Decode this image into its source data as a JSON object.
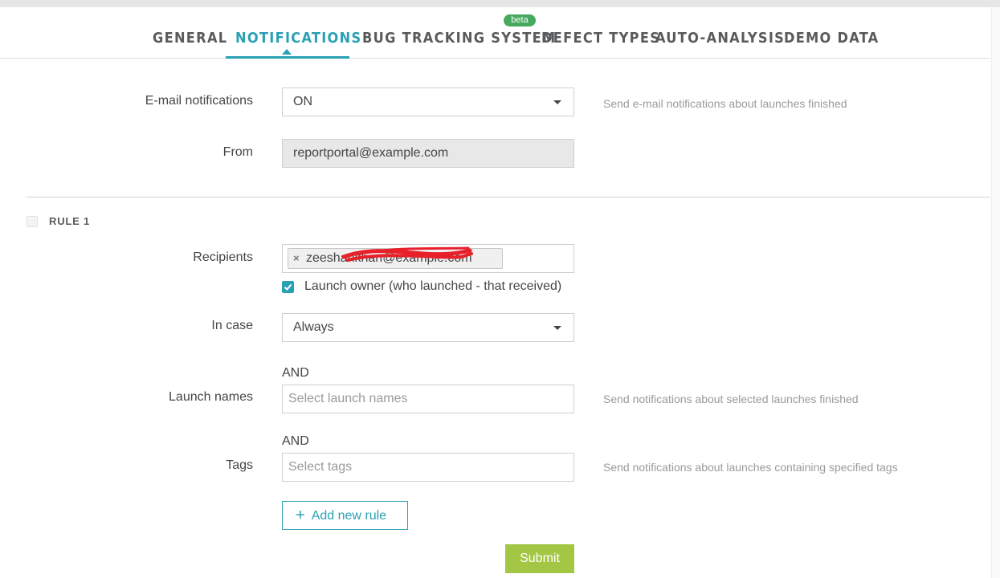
{
  "tabs": [
    {
      "label": "GENERAL"
    },
    {
      "label": "NOTIFICATIONS"
    },
    {
      "label": "BUG TRACKING SYSTEM",
      "badge": "beta"
    },
    {
      "label": "DEFECT TYPES"
    },
    {
      "label": "AUTO-ANALYSIS"
    },
    {
      "label": "DEMO DATA"
    }
  ],
  "email_notifications": {
    "label": "E-mail notifications",
    "value": "ON",
    "hint": "Send e-mail notifications about launches finished"
  },
  "from": {
    "label": "From",
    "value": "reportportal@example.com"
  },
  "rule": {
    "title": "RULE 1",
    "recipients_label": "Recipients",
    "recipient_tag": "zeeshankhan@example.com",
    "launch_owner_label": "Launch owner (who launched - that received)",
    "in_case_label": "In case",
    "in_case_value": "Always",
    "and_label_1": "AND",
    "launch_names_label": "Launch names",
    "launch_names_placeholder": "Select launch names",
    "launch_names_hint": "Send notifications about selected launches finished",
    "and_label_2": "AND",
    "tags_label": "Tags",
    "tags_placeholder": "Select tags",
    "tags_hint": "Send notifications about launches containing specified tags"
  },
  "buttons": {
    "add_rule": "Add new rule",
    "submit": "Submit"
  },
  "colors": {
    "accent": "#2aa0b4",
    "submit": "#a3c644",
    "beta_badge": "#47a85f",
    "redaction": "#e8202a"
  }
}
